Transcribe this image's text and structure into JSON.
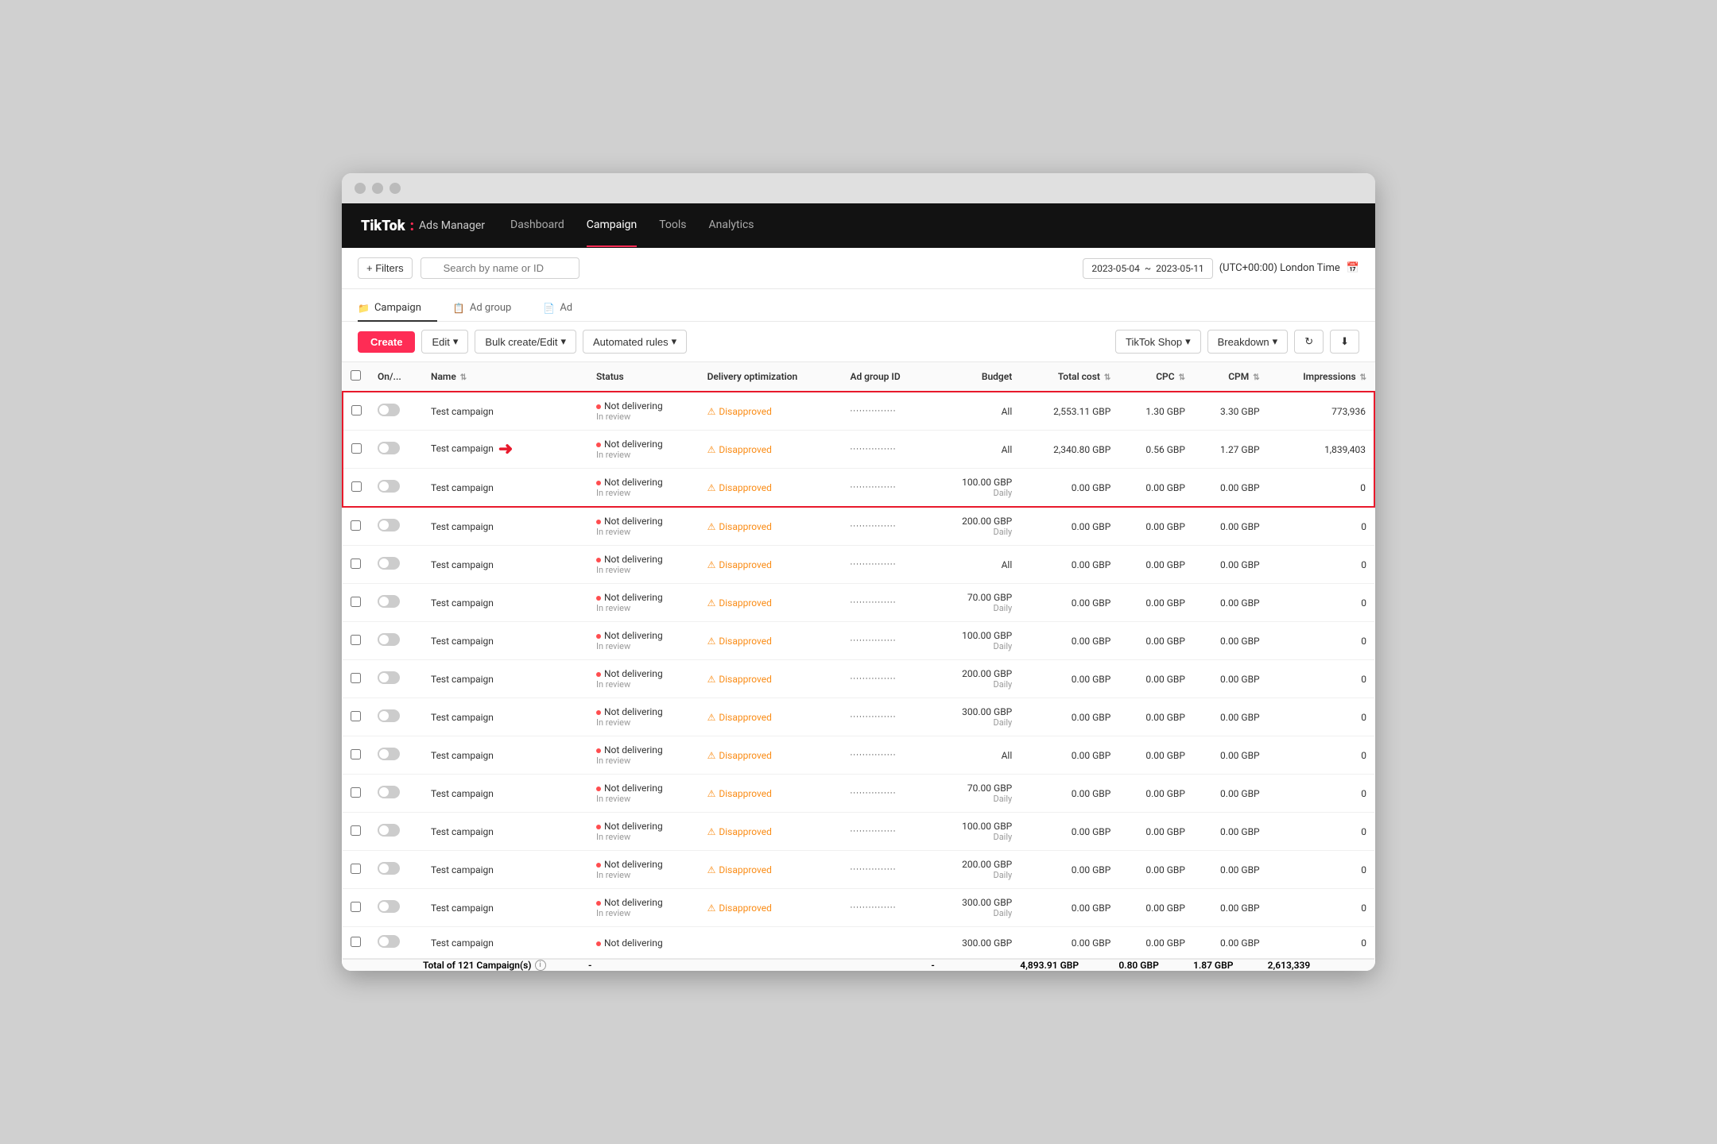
{
  "browser": {
    "dots": [
      "dot1",
      "dot2",
      "dot3"
    ]
  },
  "nav": {
    "logo_tiktok": "TikTok",
    "logo_colon": ":",
    "logo_ads": "Ads Manager",
    "items": [
      {
        "label": "Dashboard",
        "active": false
      },
      {
        "label": "Campaign",
        "active": true
      },
      {
        "label": "Tools",
        "active": false
      },
      {
        "label": "Analytics",
        "active": false
      }
    ]
  },
  "filter_bar": {
    "filter_btn": "+ Filters",
    "search_placeholder": "Search by name or ID",
    "date_start": "2023-05-04",
    "date_separator": "~",
    "date_end": "2023-05-11",
    "timezone": "(UTC+00:00) London Time",
    "cal_icon": "📅"
  },
  "breadcrumb": {
    "items": [
      {
        "icon": "📁",
        "label": "Campaign",
        "active": true
      },
      {
        "icon": "📋",
        "label": "Ad group",
        "active": false
      },
      {
        "icon": "📄",
        "label": "Ad",
        "active": false
      }
    ]
  },
  "toolbar": {
    "create_label": "Create",
    "edit_label": "Edit",
    "bulk_create_label": "Bulk create/Edit",
    "automated_rules_label": "Automated rules",
    "tiktok_shop_label": "TikTok Shop",
    "breakdown_label": "Breakdown",
    "refresh_icon": "↻",
    "download_icon": "⬇"
  },
  "table": {
    "headers": [
      {
        "key": "on_off",
        "label": "On/..."
      },
      {
        "key": "name",
        "label": "Name",
        "sort": true
      },
      {
        "key": "status",
        "label": "Status"
      },
      {
        "key": "delivery",
        "label": "Delivery optimization"
      },
      {
        "key": "ad_group_id",
        "label": "Ad group ID"
      },
      {
        "key": "budget",
        "label": "Budget",
        "sort": false,
        "align": "right"
      },
      {
        "key": "total_cost",
        "label": "Total cost",
        "sort": true,
        "align": "right"
      },
      {
        "key": "cpc",
        "label": "CPC",
        "sort": true,
        "align": "right"
      },
      {
        "key": "cpm",
        "label": "CPM",
        "sort": true,
        "align": "right"
      },
      {
        "key": "impressions",
        "label": "Impressions",
        "sort": true,
        "align": "right"
      }
    ],
    "rows": [
      {
        "name": "Test campaign",
        "status": "Not delivering",
        "status_sub": "In review",
        "delivery": "Disapproved",
        "id": "···············",
        "budget": "All",
        "budget_sub": "",
        "total_cost": "2,553.11 GBP",
        "cpc": "1.30 GBP",
        "cpm": "3.30 GBP",
        "impressions": "773,936",
        "highlighted": true
      },
      {
        "name": "Test campaign",
        "status": "Not delivering",
        "status_sub": "In review",
        "delivery": "Disapproved",
        "id": "···············",
        "budget": "All",
        "budget_sub": "",
        "total_cost": "2,340.80 GBP",
        "cpc": "0.56 GBP",
        "cpm": "1.27 GBP",
        "impressions": "1,839,403",
        "highlighted": true,
        "has_arrow": true
      },
      {
        "name": "Test campaign",
        "status": "Not delivering",
        "status_sub": "In review",
        "delivery": "Disapproved",
        "id": "···············",
        "budget": "100.00 GBP",
        "budget_sub": "Daily",
        "total_cost": "0.00 GBP",
        "cpc": "0.00 GBP",
        "cpm": "0.00 GBP",
        "impressions": "0",
        "highlighted": true
      },
      {
        "name": "Test campaign",
        "status": "Not delivering",
        "status_sub": "In review",
        "delivery": "Disapproved",
        "id": "···············",
        "budget": "200.00 GBP",
        "budget_sub": "Daily",
        "total_cost": "0.00 GBP",
        "cpc": "0.00 GBP",
        "cpm": "0.00 GBP",
        "impressions": "0",
        "highlighted": false
      },
      {
        "name": "Test campaign",
        "status": "Not delivering",
        "status_sub": "In review",
        "delivery": "Disapproved",
        "id": "···············",
        "budget": "All",
        "budget_sub": "",
        "total_cost": "0.00 GBP",
        "cpc": "0.00 GBP",
        "cpm": "0.00 GBP",
        "impressions": "0",
        "highlighted": false
      },
      {
        "name": "Test campaign",
        "status": "Not delivering",
        "status_sub": "In review",
        "delivery": "Disapproved",
        "id": "···············",
        "budget": "70.00 GBP",
        "budget_sub": "Daily",
        "total_cost": "0.00 GBP",
        "cpc": "0.00 GBP",
        "cpm": "0.00 GBP",
        "impressions": "0",
        "highlighted": false
      },
      {
        "name": "Test campaign",
        "status": "Not delivering",
        "status_sub": "In review",
        "delivery": "Disapproved",
        "id": "···············",
        "budget": "100.00 GBP",
        "budget_sub": "Daily",
        "total_cost": "0.00 GBP",
        "cpc": "0.00 GBP",
        "cpm": "0.00 GBP",
        "impressions": "0",
        "highlighted": false
      },
      {
        "name": "Test campaign",
        "status": "Not delivering",
        "status_sub": "In review",
        "delivery": "Disapproved",
        "id": "···············",
        "budget": "200.00 GBP",
        "budget_sub": "Daily",
        "total_cost": "0.00 GBP",
        "cpc": "0.00 GBP",
        "cpm": "0.00 GBP",
        "impressions": "0",
        "highlighted": false
      },
      {
        "name": "Test campaign",
        "status": "Not delivering",
        "status_sub": "In review",
        "delivery": "Disapproved",
        "id": "···············",
        "budget": "300.00 GBP",
        "budget_sub": "Daily",
        "total_cost": "0.00 GBP",
        "cpc": "0.00 GBP",
        "cpm": "0.00 GBP",
        "impressions": "0",
        "highlighted": false
      },
      {
        "name": "Test campaign",
        "status": "Not delivering",
        "status_sub": "In review",
        "delivery": "Disapproved",
        "id": "···············",
        "budget": "All",
        "budget_sub": "",
        "total_cost": "0.00 GBP",
        "cpc": "0.00 GBP",
        "cpm": "0.00 GBP",
        "impressions": "0",
        "highlighted": false
      },
      {
        "name": "Test campaign",
        "status": "Not delivering",
        "status_sub": "In review",
        "delivery": "Disapproved",
        "id": "···············",
        "budget": "70.00 GBP",
        "budget_sub": "Daily",
        "total_cost": "0.00 GBP",
        "cpc": "0.00 GBP",
        "cpm": "0.00 GBP",
        "impressions": "0",
        "highlighted": false
      },
      {
        "name": "Test campaign",
        "status": "Not delivering",
        "status_sub": "In review",
        "delivery": "Disapproved",
        "id": "···············",
        "budget": "100.00 GBP",
        "budget_sub": "Daily",
        "total_cost": "0.00 GBP",
        "cpc": "0.00 GBP",
        "cpm": "0.00 GBP",
        "impressions": "0",
        "highlighted": false
      },
      {
        "name": "Test campaign",
        "status": "Not delivering",
        "status_sub": "In review",
        "delivery": "Disapproved",
        "id": "···············",
        "budget": "200.00 GBP",
        "budget_sub": "Daily",
        "total_cost": "0.00 GBP",
        "cpc": "0.00 GBP",
        "cpm": "0.00 GBP",
        "impressions": "0",
        "highlighted": false
      },
      {
        "name": "Test campaign",
        "status": "Not delivering",
        "status_sub": "In review",
        "delivery": "Disapproved",
        "id": "···············",
        "budget": "300.00 GBP",
        "budget_sub": "Daily",
        "total_cost": "0.00 GBP",
        "cpc": "0.00 GBP",
        "cpm": "0.00 GBP",
        "impressions": "0",
        "highlighted": false
      },
      {
        "name": "Test campaign",
        "status": "Not delivering",
        "status_sub": "",
        "delivery": "",
        "id": "",
        "budget": "300.00 GBP",
        "budget_sub": "",
        "total_cost": "0.00 GBP",
        "cpc": "0.00 GBP",
        "cpm": "0.00 GBP",
        "impressions": "0",
        "highlighted": false
      }
    ],
    "footer": {
      "label": "Total of 121 Campaign(s)",
      "info": "ℹ",
      "budget": "-",
      "total_cost": "4,893.91 GBP",
      "cpc": "0.80 GBP",
      "cpm": "1.87 GBP",
      "impressions": "2,613,339"
    }
  }
}
